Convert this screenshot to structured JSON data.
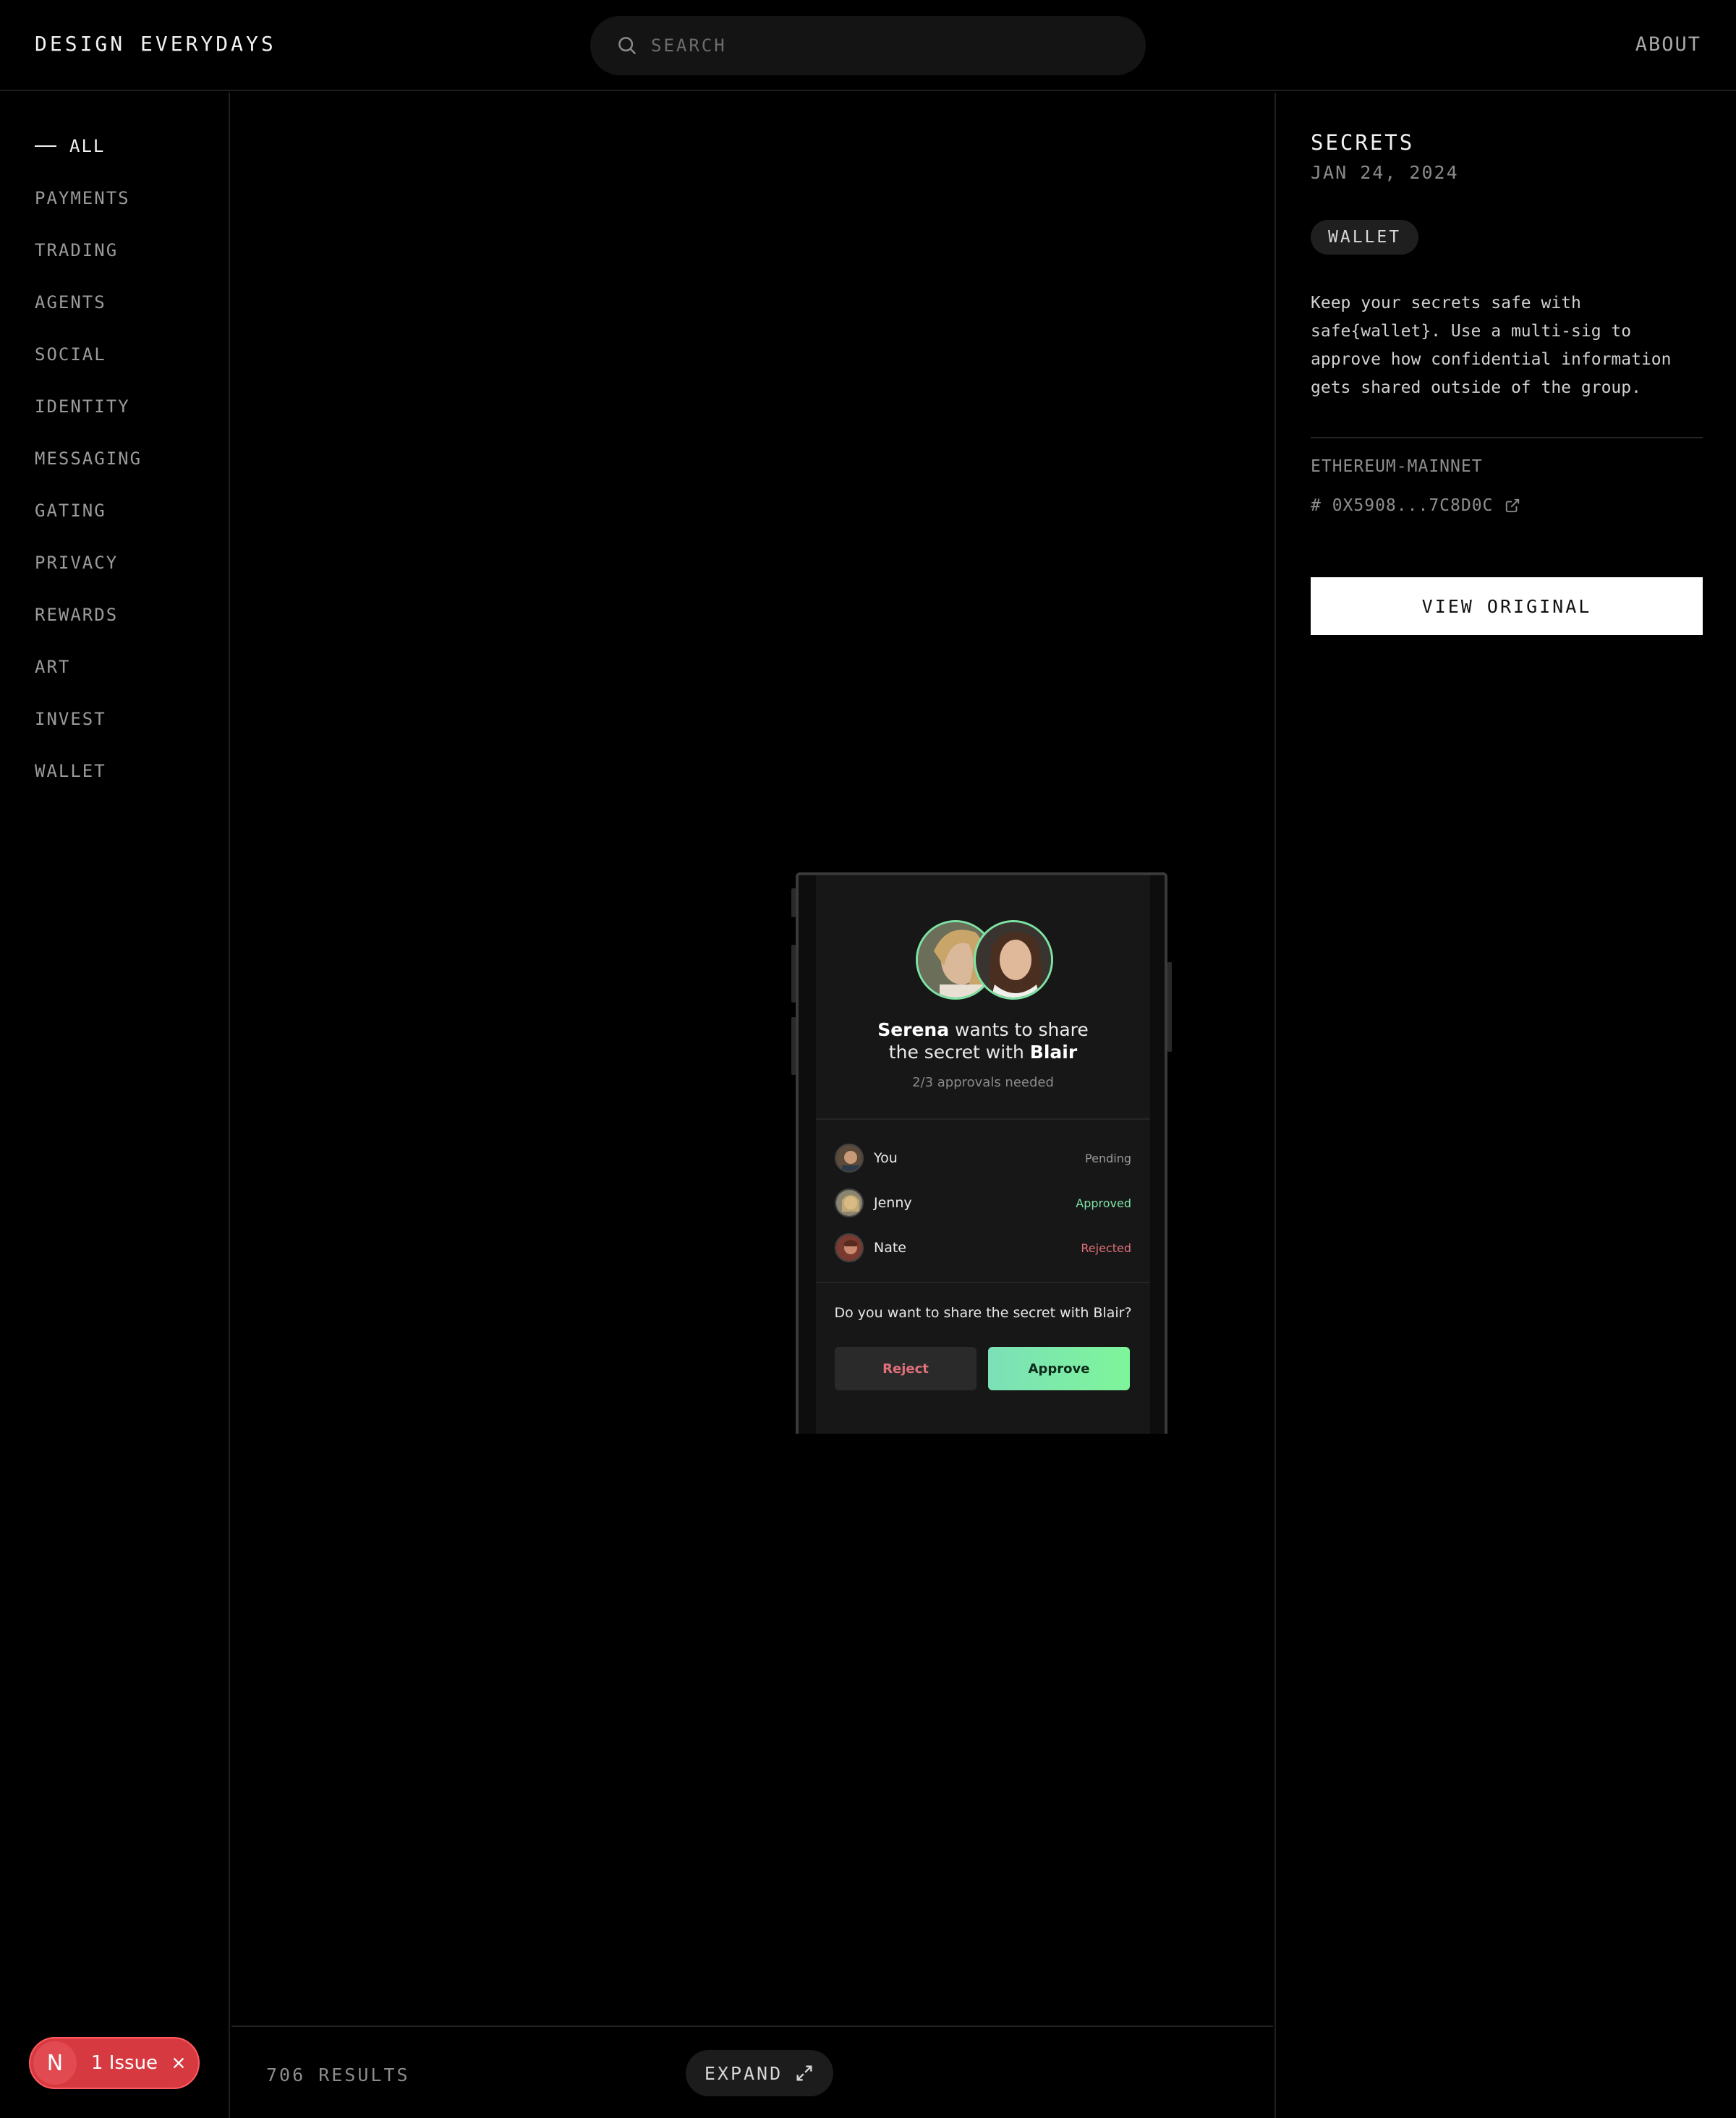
{
  "header": {
    "brand": "DESIGN EVERYDAYS",
    "search_placeholder": "SEARCH",
    "about_label": "ABOUT"
  },
  "sidebar": {
    "items": [
      {
        "label": "ALL",
        "active": true
      },
      {
        "label": "PAYMENTS"
      },
      {
        "label": "TRADING"
      },
      {
        "label": "AGENTS"
      },
      {
        "label": "SOCIAL"
      },
      {
        "label": "IDENTITY"
      },
      {
        "label": "MESSAGING"
      },
      {
        "label": "GATING"
      },
      {
        "label": "PRIVACY"
      },
      {
        "label": "REWARDS"
      },
      {
        "label": "ART"
      },
      {
        "label": "INVEST"
      },
      {
        "label": "WALLET"
      }
    ]
  },
  "preview": {
    "title_name1": "Serena",
    "title_mid": " wants to share",
    "title_line2": "the secret with ",
    "title_name2": "Blair",
    "approvals_text": "2/3 approvals needed",
    "approvers": [
      {
        "name": "You",
        "status": "Pending",
        "status_color": "#9a9a9a"
      },
      {
        "name": "Jenny",
        "status": "Approved",
        "status_color": "#7fe3a5"
      },
      {
        "name": "Nate",
        "status": "Rejected",
        "status_color": "#e0707a"
      }
    ],
    "question": "Do you want to share the secret with Blair?",
    "reject_label": "Reject",
    "approve_label": "Approve"
  },
  "footer": {
    "results_text": "706 RESULTS",
    "expand_label": "EXPAND"
  },
  "detail": {
    "title": "SECRETS",
    "date": "JAN 24, 2024",
    "tag": "WALLET",
    "description": "Keep your secrets safe with safe{wallet}. Use a multi-sig to approve how confidential information gets shared outside of the group.",
    "network": "ETHEREUM-MAINNET",
    "hash": "# 0X5908...7C8D0C",
    "view_label": "VIEW ORIGINAL"
  },
  "issue_badge": {
    "letter": "N",
    "label": "1 Issue"
  },
  "colors": {
    "accent_green": "#7fe3a5",
    "reject_red": "#e0707a",
    "issue_red": "#d63a40"
  }
}
